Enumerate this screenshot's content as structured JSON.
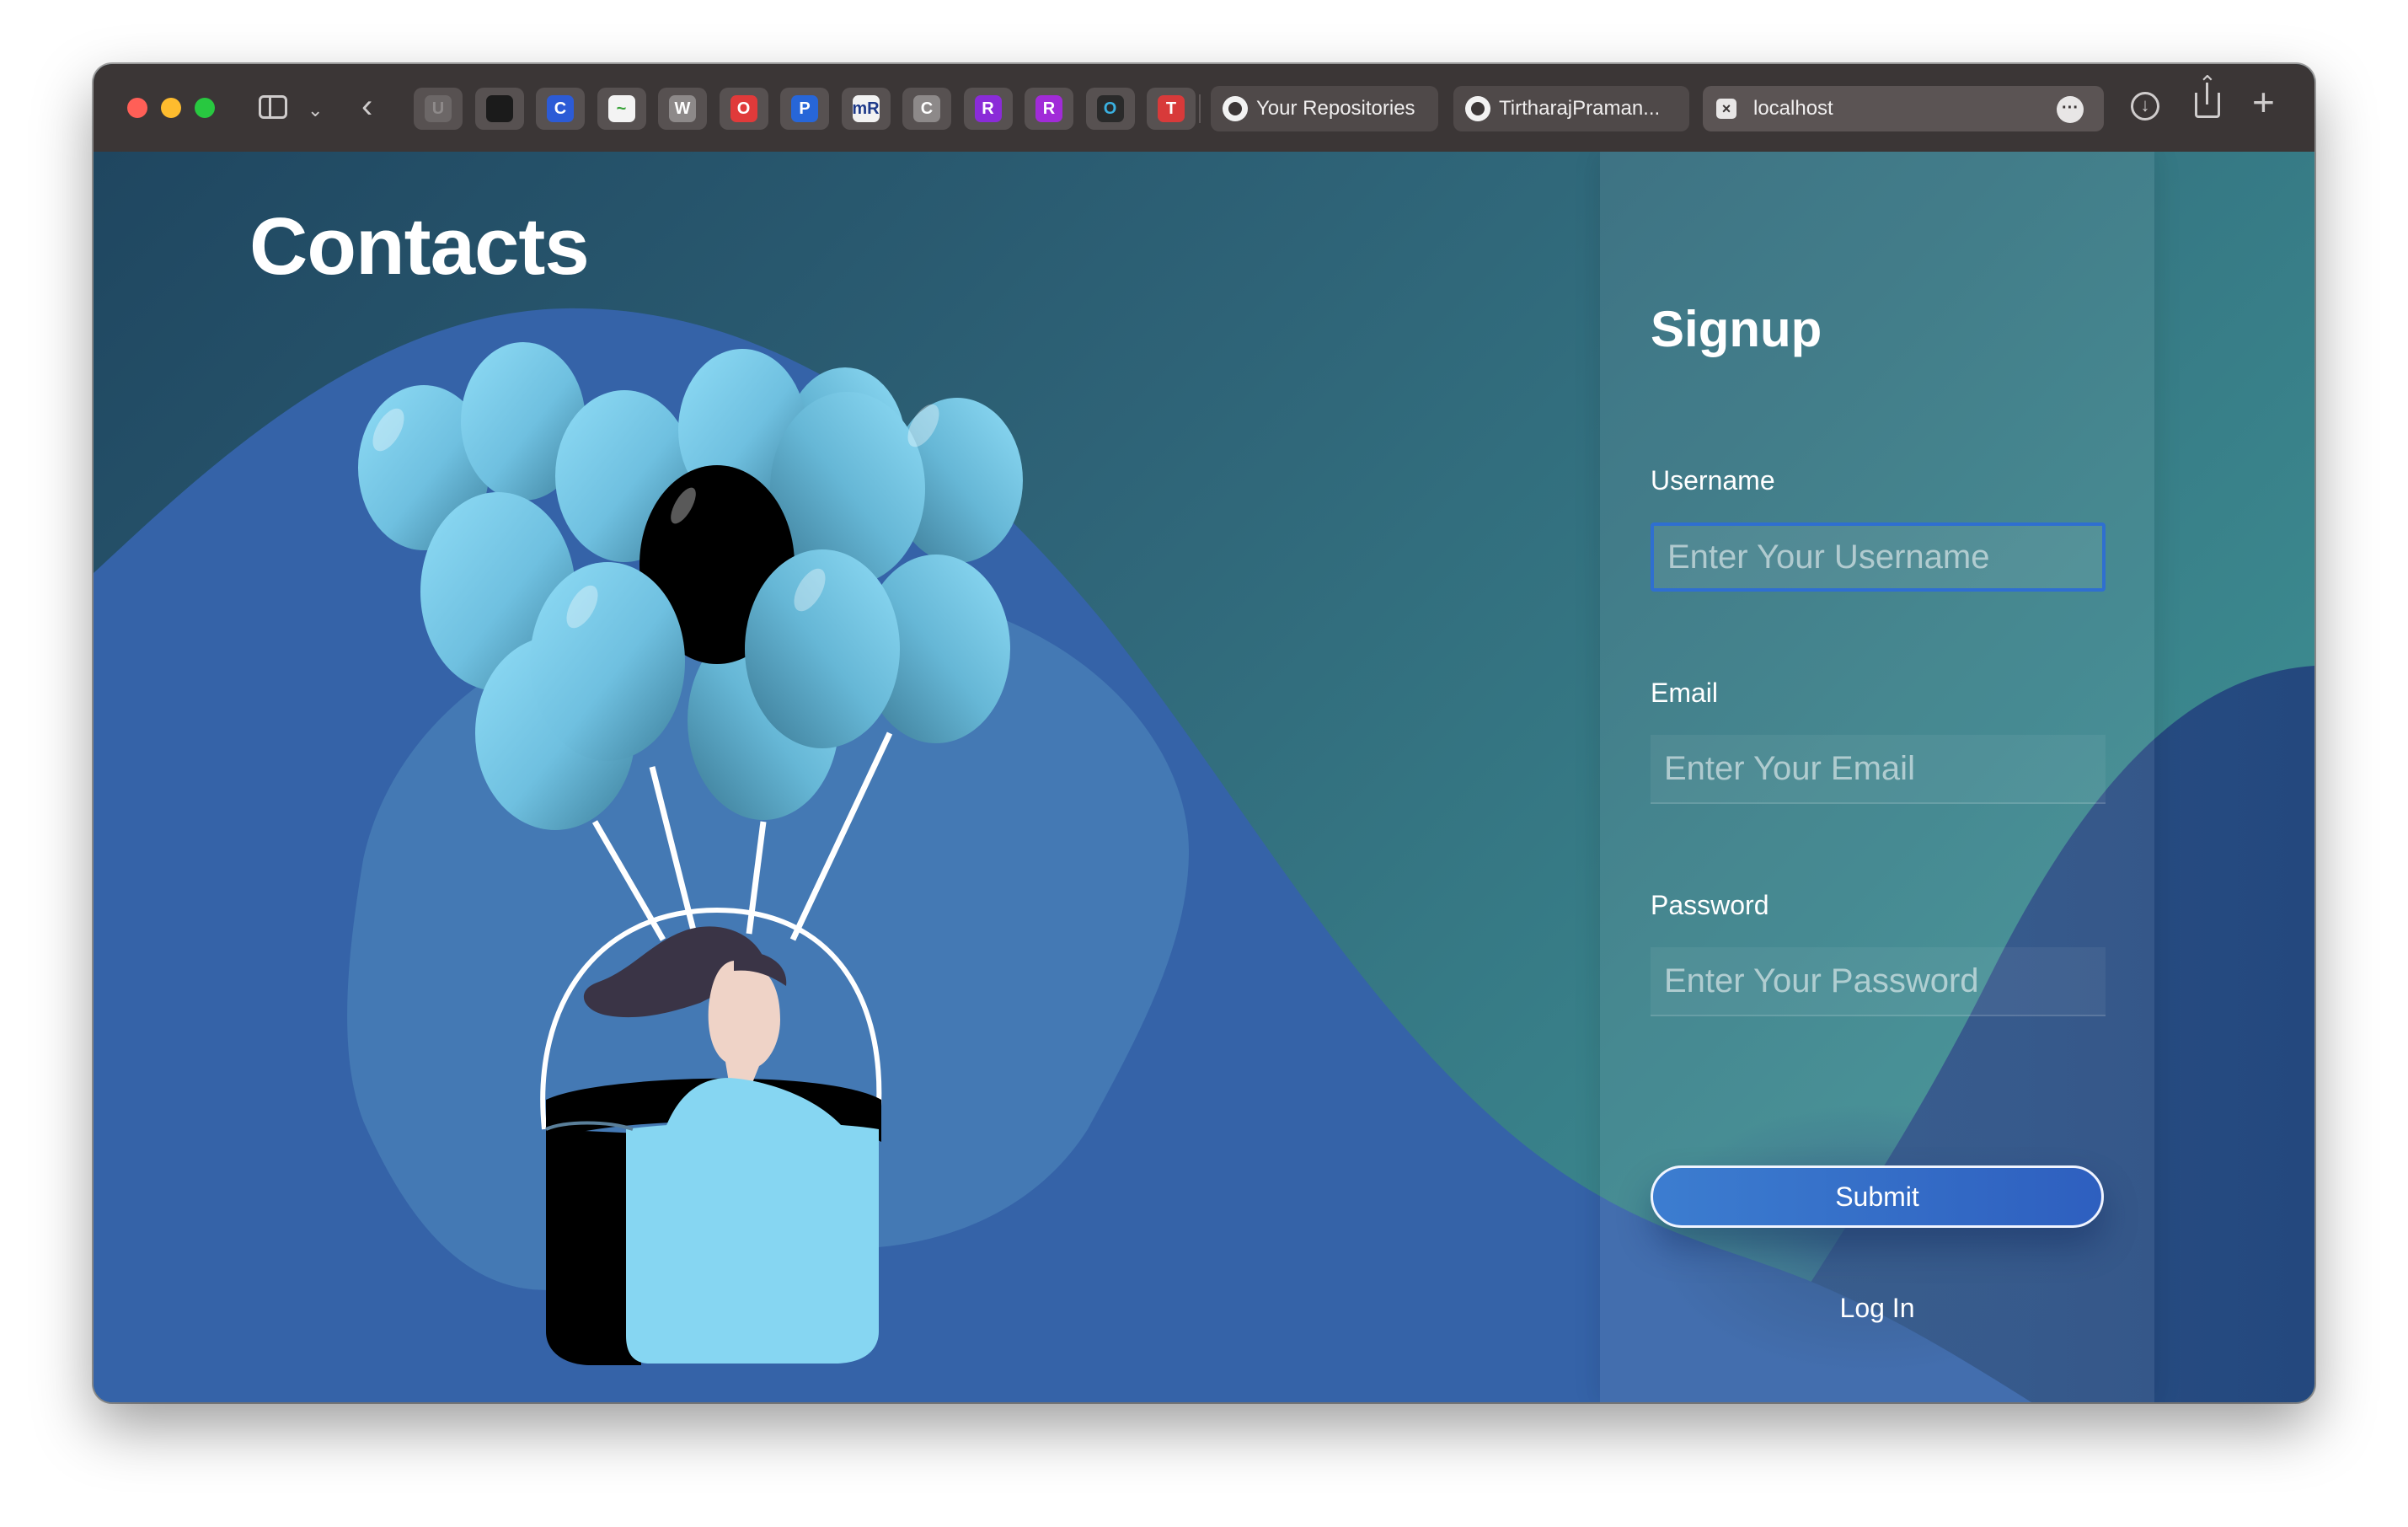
{
  "browser": {
    "tabs": [
      {
        "label": "Your Repositories"
      },
      {
        "label": "TirtharajPraman..."
      },
      {
        "label": "localhost"
      }
    ],
    "favorites": [
      {
        "glyph": "U",
        "color": "#8e8a8a",
        "bg": "#6c6767"
      },
      {
        "glyph": "",
        "color": "#ffffff",
        "bg": "#1b1b1b"
      },
      {
        "glyph": "C",
        "color": "#ffffff",
        "bg": "#2c5bd6"
      },
      {
        "glyph": "~",
        "color": "#3aa33a",
        "bg": "#f3f3f3"
      },
      {
        "glyph": "W",
        "color": "#ffffff",
        "bg": "#8d8989"
      },
      {
        "glyph": "O",
        "color": "#ffffff",
        "bg": "#e03a3a"
      },
      {
        "glyph": "P",
        "color": "#ffffff",
        "bg": "#2766d8"
      },
      {
        "glyph": "mR",
        "color": "#1e3a8a",
        "bg": "#f2f2f2"
      },
      {
        "glyph": "C",
        "color": "#ffffff",
        "bg": "#8d8989"
      },
      {
        "glyph": "R",
        "color": "#ffffff",
        "bg": "#8a2bd8"
      },
      {
        "glyph": "R",
        "color": "#ffffff",
        "bg": "#a12bd8"
      },
      {
        "glyph": "O",
        "color": "#3ab0e0",
        "bg": "#2a2a2a"
      },
      {
        "glyph": "T",
        "color": "#ffffff",
        "bg": "#d83a3a"
      }
    ]
  },
  "page": {
    "title": "Contacts"
  },
  "signup": {
    "title": "Signup",
    "username_label": "Username",
    "username_placeholder": "Enter Your Username",
    "email_label": "Email",
    "email_placeholder": "Enter Your Email",
    "password_label": "Password",
    "password_placeholder": "Enter Your Password",
    "submit_label": "Submit",
    "login_label": "Log In"
  },
  "colors": {
    "bg_top": "#1f4660",
    "bg_teal": "#3a8b90",
    "blob_blue": "#3563a8",
    "blob_light": "#4479b4",
    "balloon": "#86d6f2",
    "balloon_dark": "#4c9ab5",
    "accent": "#2f6fd0"
  }
}
